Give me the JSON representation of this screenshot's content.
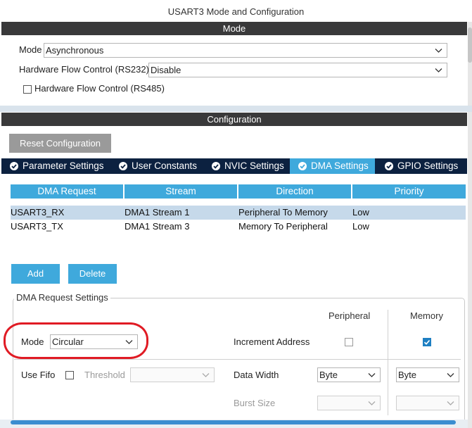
{
  "window": {
    "title": "USART3 Mode and Configuration"
  },
  "mode_section": {
    "header": "Mode",
    "mode_label": "Mode",
    "mode_value": "Asynchronous",
    "hfc232_label": "Hardware Flow Control (RS232)",
    "hfc232_value": "Disable",
    "hfc485_label": "Hardware Flow Control (RS485)",
    "hfc485_checked": false
  },
  "config_section": {
    "header": "Configuration",
    "reset_label": "Reset Configuration",
    "tabs": [
      {
        "label": "Parameter Settings",
        "active": false
      },
      {
        "label": "User Constants",
        "active": false
      },
      {
        "label": "NVIC Settings",
        "active": false
      },
      {
        "label": "DMA Settings",
        "active": true
      },
      {
        "label": "GPIO Settings",
        "active": false
      }
    ]
  },
  "dma_table": {
    "columns": [
      "DMA Request",
      "Stream",
      "Direction",
      "Priority"
    ],
    "rows": [
      {
        "request": "USART3_RX",
        "stream": "DMA1 Stream 1",
        "direction": "Peripheral To Memory",
        "priority": "Low",
        "selected": true
      },
      {
        "request": "USART3_TX",
        "stream": "DMA1 Stream 3",
        "direction": "Memory To Peripheral",
        "priority": "Low",
        "selected": false
      }
    ]
  },
  "buttons": {
    "add": "Add",
    "delete": "Delete"
  },
  "dma_settings": {
    "legend": "DMA Request Settings",
    "peripheral_header": "Peripheral",
    "memory_header": "Memory",
    "mode_label": "Mode",
    "mode_value": "Circular",
    "increment_label": "Increment Address",
    "increment_peripheral": false,
    "increment_memory": true,
    "fifo_label": "Use Fifo",
    "fifo_checked": false,
    "threshold_label": "Threshold",
    "threshold_value": "",
    "width_label": "Data Width",
    "width_peripheral": "Byte",
    "width_memory": "Byte",
    "burst_label": "Burst Size",
    "burst_peripheral": "",
    "burst_memory": ""
  },
  "colors": {
    "header_bg": "#39393a",
    "tabbar_bg": "#0c2140",
    "accent": "#3fa9dc",
    "selected_row": "#c6d9ea",
    "highlight_ring": "#e01b24"
  }
}
